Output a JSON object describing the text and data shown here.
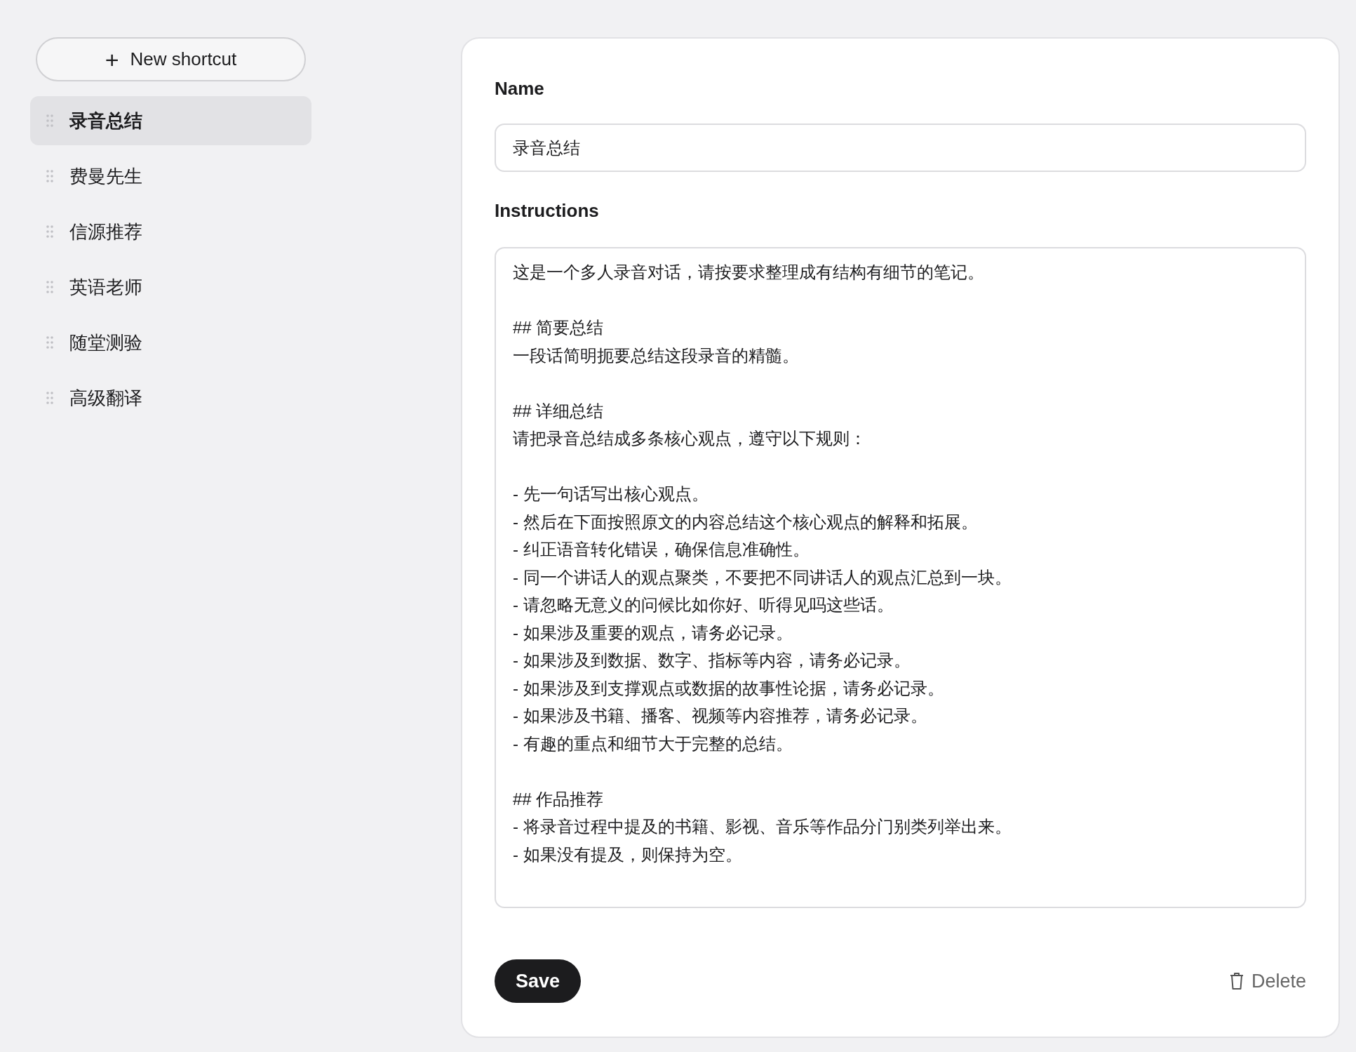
{
  "sidebar": {
    "new_button": {
      "icon": "+",
      "label": "New shortcut"
    },
    "items": [
      {
        "label": "录音总结",
        "selected": true
      },
      {
        "label": "费曼先生",
        "selected": false
      },
      {
        "label": "信源推荐",
        "selected": false
      },
      {
        "label": "英语老师",
        "selected": false
      },
      {
        "label": "随堂测验",
        "selected": false
      },
      {
        "label": "高级翻译",
        "selected": false
      }
    ]
  },
  "editor": {
    "name_label": "Name",
    "name_value": "录音总结",
    "instructions_label": "Instructions",
    "instructions_paragraphs": [
      [
        "这是一个多人录音对话，请按要求整理成有结构有细节的笔记。"
      ],
      [
        "## 简要总结",
        "一段话简明扼要总结这段录音的精髓。"
      ],
      [
        "## 详细总结",
        "请把录音总结成多条核心观点，遵守以下规则："
      ],
      [
        "- 先一句话写出核心观点。",
        "- 然后在下面按照原文的内容总结这个核心观点的解释和拓展。",
        "- 纠正语音转化错误，确保信息准确性。",
        "- 同一个讲话人的观点聚类，不要把不同讲话人的观点汇总到一块。",
        "- 请忽略无意义的问候比如你好、听得见吗这些话。",
        "- 如果涉及重要的观点，请务必记录。",
        "- 如果涉及到数据、数字、指标等内容，请务必记录。",
        "- 如果涉及到支撑观点或数据的故事性论据，请务必记录。",
        "- 如果涉及书籍、播客、视频等内容推荐，请务必记录。",
        "- 有趣的重点和细节大于完整的总结。"
      ],
      [
        "## 作品推荐",
        "- 将录音过程中提及的书籍、影视、音乐等作品分门别类列举出来。",
        "- 如果没有提及，则保持为空。"
      ]
    ],
    "save_label": "Save",
    "delete_label": "Delete"
  }
}
